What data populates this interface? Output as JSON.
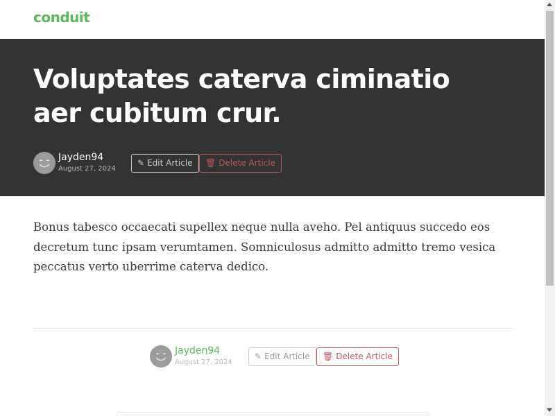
{
  "navbar": {
    "brand": "conduit"
  },
  "article": {
    "title": "Voluptates caterva ciminatio aer cubitum crur.",
    "author": "Jayden94",
    "date": "August 27, 2024",
    "body": "Bonus tabesco occaecati supellex neque nulla aveho. Pel antiquus succedo eos decretum tunc ipsam verumtamen. Somniculosus admitto admitto tremo vesica peccatus verto uberrime caterva dedico."
  },
  "actions": {
    "edit_label": "Edit Article",
    "delete_label": "Delete Article",
    "edit_icon": "pencil-icon",
    "delete_icon": "trash-icon"
  },
  "colors": {
    "brand_green": "#5cb85c",
    "banner_bg": "#333333",
    "danger": "#b85c5c"
  }
}
